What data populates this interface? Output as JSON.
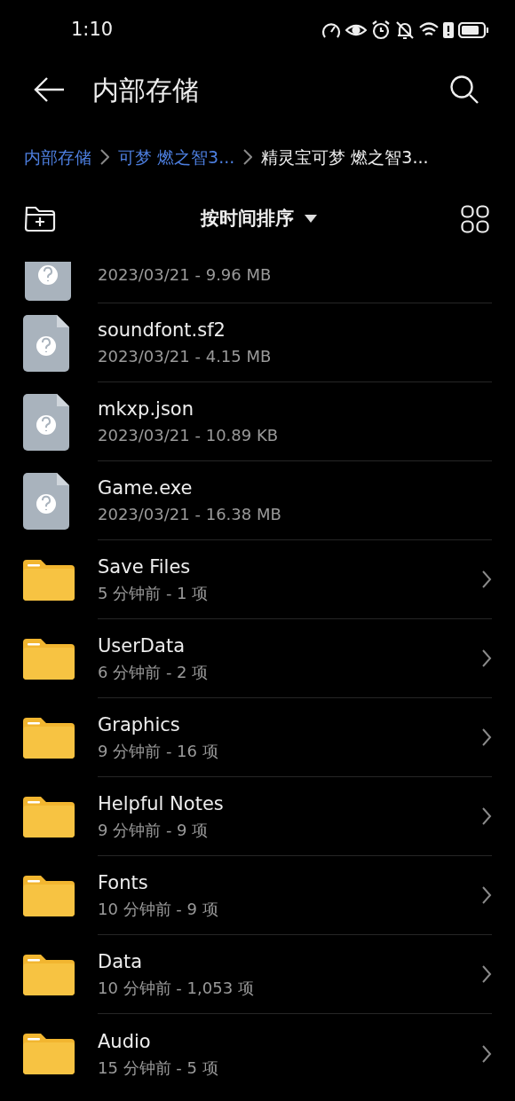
{
  "status_bar": {
    "time": "1:10"
  },
  "header": {
    "title": "内部存储"
  },
  "breadcrumb": [
    {
      "label": "内部存储",
      "selected": false
    },
    {
      "label": "可梦 燃之智3...",
      "selected": false
    },
    {
      "label": "精灵宝可梦 燃之智3...",
      "selected": true
    }
  ],
  "toolbar": {
    "sort_label": "按时间排序"
  },
  "items": [
    {
      "kind": "partial",
      "subtitle": "2023/03/21 - 9.96 MB"
    },
    {
      "kind": "file",
      "name": "soundfont.sf2",
      "subtitle": "2023/03/21 - 4.15 MB"
    },
    {
      "kind": "file",
      "name": "mkxp.json",
      "subtitle": "2023/03/21 - 10.89 KB"
    },
    {
      "kind": "file",
      "name": "Game.exe",
      "subtitle": "2023/03/21 - 16.38 MB"
    },
    {
      "kind": "folder",
      "name": "Save Files",
      "subtitle": "5 分钟前 - 1 项"
    },
    {
      "kind": "folder",
      "name": "UserData",
      "subtitle": "6 分钟前 - 2 项"
    },
    {
      "kind": "folder",
      "name": "Graphics",
      "subtitle": "9 分钟前 - 16 项"
    },
    {
      "kind": "folder",
      "name": "Helpful Notes",
      "subtitle": "9 分钟前 - 9 项"
    },
    {
      "kind": "folder",
      "name": "Fonts",
      "subtitle": "10 分钟前 - 9 项"
    },
    {
      "kind": "folder",
      "name": "Data",
      "subtitle": "10 分钟前 - 1,053 项"
    },
    {
      "kind": "folder",
      "name": "Audio",
      "subtitle": "15 分钟前 - 5 项"
    }
  ]
}
